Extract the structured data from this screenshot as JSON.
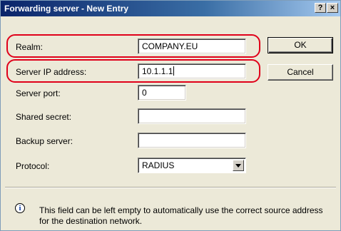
{
  "window": {
    "title": "Forwarding server - New Entry",
    "help_button": "?",
    "close_button": "×"
  },
  "form": {
    "realm_label": "Realm:",
    "realm_value": "COMPANY.EU",
    "server_ip_label": "Server IP address:",
    "server_ip_value": "10.1.1.1",
    "server_port_label": "Server port:",
    "server_port_value": "0",
    "shared_secret_label": "Shared secret:",
    "shared_secret_value": "",
    "backup_server_label": "Backup server:",
    "backup_server_value": "",
    "protocol_label": "Protocol:",
    "protocol_value": "RADIUS"
  },
  "buttons": {
    "ok_label": "OK",
    "cancel_label": "Cancel"
  },
  "info": {
    "text": "This field can be left empty to automatically use the correct source address for the destination network."
  },
  "colors": {
    "highlight": "#e0001a",
    "title_bar": "#0a246a"
  }
}
